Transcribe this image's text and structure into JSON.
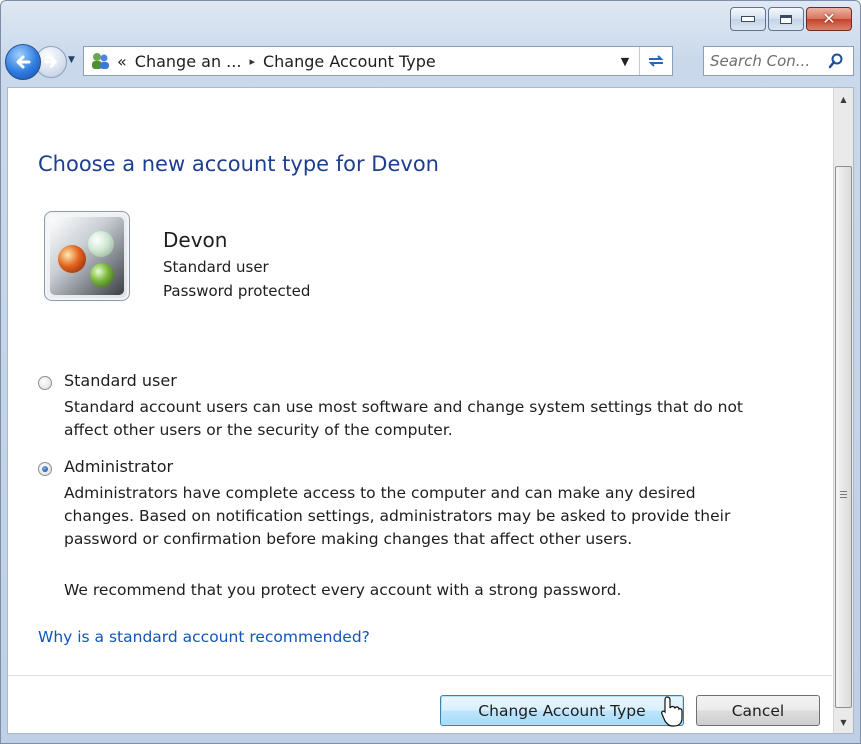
{
  "window": {
    "caption_buttons": {
      "minimize": "minimize-icon",
      "maximize": "maximize-icon",
      "close": "close-icon"
    }
  },
  "nav": {
    "breadcrumbs": [
      "«",
      "Change an ...",
      "Change Account Type"
    ],
    "separator": "▸",
    "search_placeholder": "Search Con..."
  },
  "main": {
    "title": "Choose a new account type for Devon",
    "user": {
      "name": "Devon",
      "type": "Standard user",
      "status": "Password protected"
    },
    "options": [
      {
        "label": "Standard user",
        "desc_lines": [
          "Standard account users can use most software and change system settings that do not",
          "affect other users or the security of the computer."
        ],
        "selected": false
      },
      {
        "label": "Administrator",
        "desc_lines": [
          "Administrators have complete access to the computer and can make any desired",
          "changes. Based on notification settings, administrators may be asked to provide their",
          "password or confirmation before making changes that affect other users."
        ],
        "selected": true
      }
    ],
    "recommendation": "We recommend that you protect every account with a strong password.",
    "help_link": "Why is a standard account recommended?"
  },
  "buttons": {
    "primary": "Change Account Type",
    "cancel": "Cancel"
  },
  "colors": {
    "title": "#1e3e8e",
    "link": "#1155bb",
    "accent": "#3c7fb1"
  }
}
